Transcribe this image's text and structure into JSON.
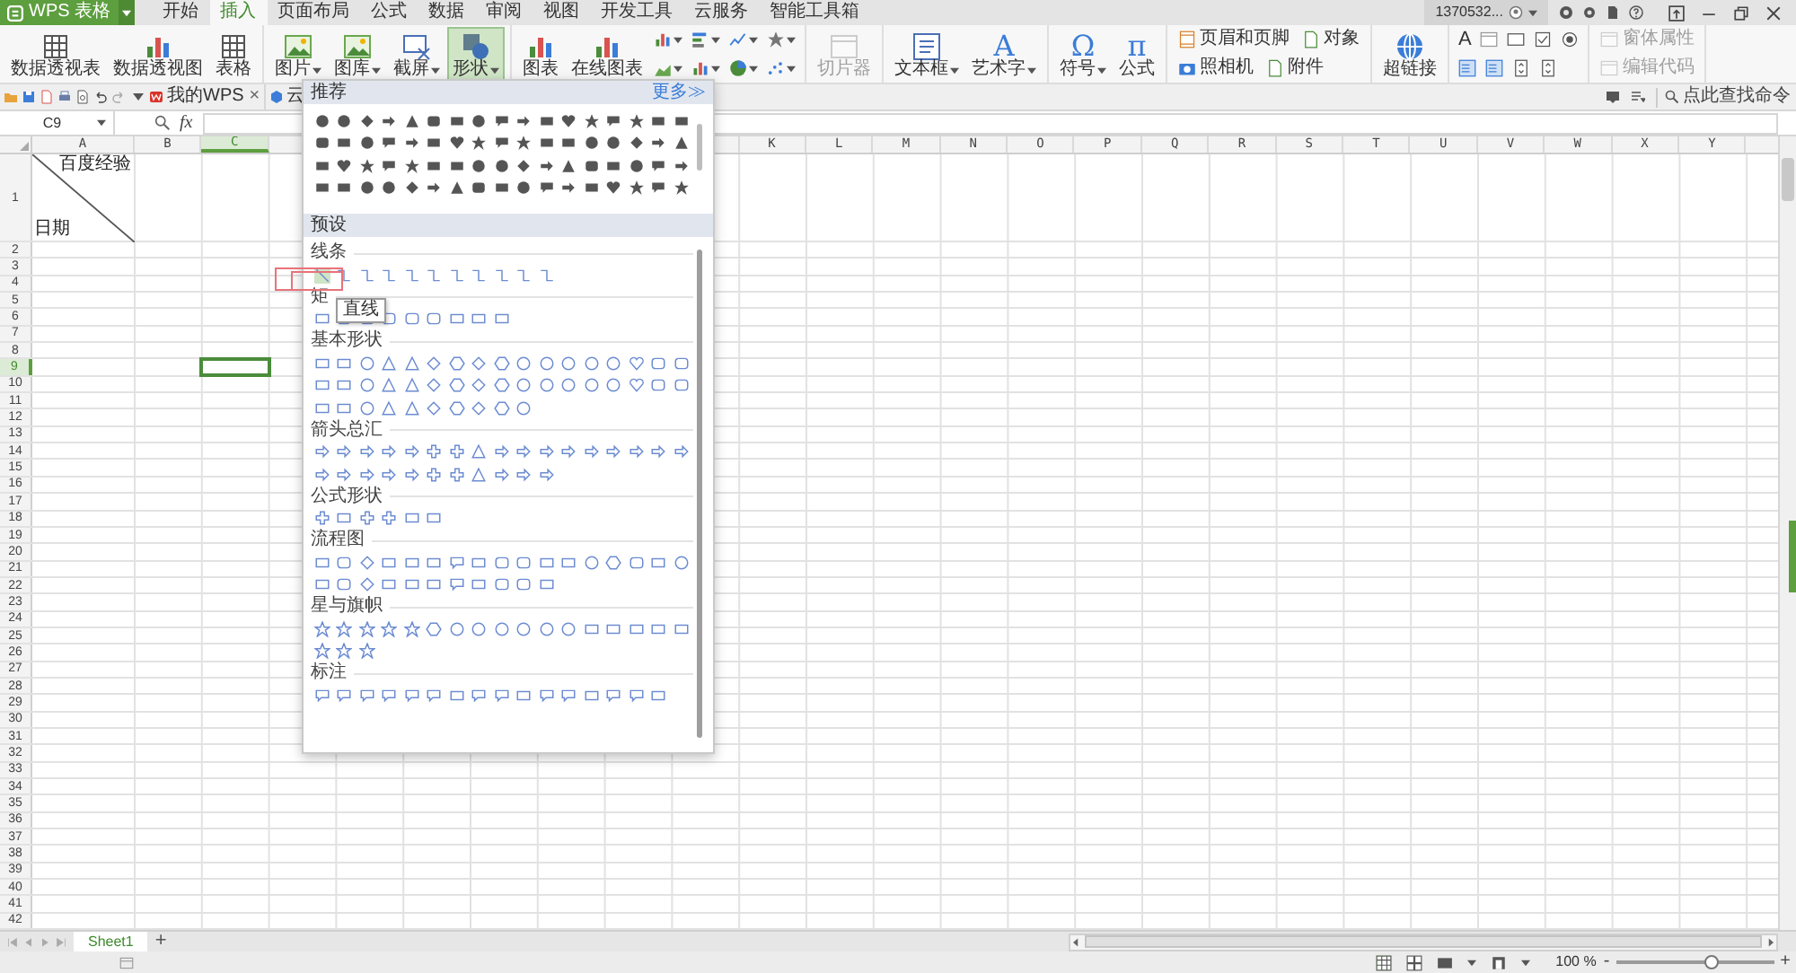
{
  "app_menu": {
    "label": "WPS 表格"
  },
  "menu_tabs": [
    {
      "label": "开始",
      "selected": false
    },
    {
      "label": "插入",
      "selected": true
    },
    {
      "label": "页面布局",
      "selected": false
    },
    {
      "label": "公式",
      "selected": false
    },
    {
      "label": "数据",
      "selected": false
    },
    {
      "label": "审阅",
      "selected": false
    },
    {
      "label": "视图",
      "selected": false
    },
    {
      "label": "开发工具",
      "selected": false
    },
    {
      "label": "云服务",
      "selected": false
    },
    {
      "label": "智能工具箱",
      "selected": false
    }
  ],
  "account": {
    "label": "1370532..."
  },
  "ribbon_groups": [
    {
      "items": [
        {
          "kind": "large",
          "label": "数据透视表",
          "dropdown": false,
          "selected": false,
          "disabled": false
        },
        {
          "kind": "large",
          "label": "数据透视图",
          "dropdown": false,
          "selected": false,
          "disabled": false
        },
        {
          "kind": "large",
          "label": "表格",
          "dropdown": false,
          "selected": false,
          "disabled": false
        }
      ]
    },
    {
      "items": [
        {
          "kind": "large",
          "label": "图片",
          "dropdown": true,
          "selected": false,
          "disabled": false
        },
        {
          "kind": "large",
          "label": "图库",
          "dropdown": true,
          "selected": false,
          "disabled": false
        },
        {
          "kind": "large",
          "label": "截屏",
          "dropdown": true,
          "selected": false,
          "disabled": false
        },
        {
          "kind": "large",
          "label": "形状",
          "dropdown": true,
          "selected": true,
          "disabled": false
        }
      ]
    },
    {
      "items": [
        {
          "kind": "large",
          "label": "图表",
          "dropdown": false,
          "selected": false,
          "disabled": false
        },
        {
          "kind": "large",
          "label": "在线图表",
          "dropdown": false,
          "selected": false,
          "disabled": false
        },
        {
          "kind": "icon",
          "dropdown": true,
          "selected": false,
          "disabled": false
        },
        {
          "kind": "icon",
          "dropdown": true,
          "selected": false,
          "disabled": false
        },
        {
          "kind": "icon",
          "dropdown": true,
          "selected": false,
          "disabled": false
        },
        {
          "kind": "icon",
          "dropdown": true,
          "selected": false,
          "disabled": false
        },
        {
          "kind": "icon",
          "dropdown": true,
          "selected": false,
          "disabled": false
        },
        {
          "kind": "icon",
          "dropdown": true,
          "selected": false,
          "disabled": false
        },
        {
          "kind": "icon",
          "dropdown": true,
          "selected": false,
          "disabled": false
        },
        {
          "kind": "icon",
          "dropdown": true,
          "selected": false,
          "disabled": false
        }
      ]
    },
    {
      "items": [
        {
          "kind": "large",
          "label": "切片器",
          "dropdown": false,
          "selected": false,
          "disabled": true
        }
      ]
    },
    {
      "items": [
        {
          "kind": "large",
          "label": "文本框",
          "dropdown": true,
          "selected": false,
          "disabled": false
        },
        {
          "kind": "large_glyph",
          "glyph": "A",
          "label": "艺术字",
          "dropdown": true,
          "selected": false,
          "disabled": false
        }
      ]
    },
    {
      "items": [
        {
          "kind": "large_glyph",
          "glyph": "Ω",
          "label": "符号",
          "dropdown": true,
          "selected": false,
          "disabled": false
        },
        {
          "kind": "large_glyph",
          "glyph": "π",
          "label": "公式",
          "dropdown": false,
          "selected": false,
          "disabled": false
        }
      ]
    },
    {
      "items": [
        {
          "kind": "small",
          "label": "页眉和页脚",
          "dropdown": false,
          "selected": false,
          "disabled": false
        },
        {
          "kind": "small",
          "label": "对象",
          "dropdown": false,
          "selected": false,
          "disabled": false
        },
        {
          "kind": "small",
          "label": "照相机",
          "dropdown": false,
          "selected": false,
          "disabled": false
        },
        {
          "kind": "small",
          "label": "附件",
          "dropdown": false,
          "selected": false,
          "disabled": false
        }
      ]
    },
    {
      "items": [
        {
          "kind": "large",
          "label": "超链接",
          "dropdown": false,
          "selected": false,
          "disabled": false
        }
      ]
    },
    {
      "items": [
        {
          "kind": "glyph",
          "glyph": "A",
          "dropdown": false,
          "selected": false,
          "disabled": false
        },
        {
          "kind": "icon",
          "dropdown": false,
          "selected": false,
          "disabled": false
        },
        {
          "kind": "icon",
          "dropdown": false,
          "selected": false,
          "disabled": false
        },
        {
          "kind": "icon",
          "dropdown": false,
          "selected": false,
          "disabled": false
        },
        {
          "kind": "icon",
          "dropdown": false,
          "selected": false,
          "disabled": false
        },
        {
          "kind": "icon",
          "dropdown": false,
          "selected": false,
          "disabled": false
        },
        {
          "kind": "icon",
          "dropdown": false,
          "selected": false,
          "disabled": false
        },
        {
          "kind": "icon",
          "dropdown": false,
          "selected": false,
          "disabled": false
        },
        {
          "kind": "icon",
          "dropdown": false,
          "selected": false,
          "disabled": false
        }
      ]
    },
    {
      "items": [
        {
          "kind": "small",
          "label": "窗体属性",
          "dropdown": false,
          "selected": false,
          "disabled": true
        },
        {
          "kind": "small",
          "label": "编辑代码",
          "dropdown": false,
          "selected": false,
          "disabled": true
        }
      ]
    }
  ],
  "doc_tabs": [
    {
      "label": "我的WPS",
      "close": "×"
    },
    {
      "label": "云"
    }
  ],
  "command_search": {
    "placeholder": "点此查找命令"
  },
  "formula_bar": {
    "cell_name": "C9",
    "fx": "fx"
  },
  "sheet": {
    "columns": [
      {
        "label": "A",
        "selected": false
      },
      {
        "label": "B",
        "selected": false
      },
      {
        "label": "C",
        "selected": true
      },
      {
        "label": "K",
        "selected": false
      },
      {
        "label": "L",
        "selected": false
      },
      {
        "label": "M",
        "selected": false
      },
      {
        "label": "N",
        "selected": false
      },
      {
        "label": "O",
        "selected": false
      },
      {
        "label": "P",
        "selected": false
      },
      {
        "label": "Q",
        "selected": false
      },
      {
        "label": "R",
        "selected": false
      },
      {
        "label": "S",
        "selected": false
      },
      {
        "label": "T",
        "selected": false
      },
      {
        "label": "U",
        "selected": false
      },
      {
        "label": "V",
        "selected": false
      },
      {
        "label": "W",
        "selected": false
      },
      {
        "label": "X",
        "selected": false
      },
      {
        "label": "Y",
        "selected": false
      }
    ],
    "rows": [
      {
        "label": "1",
        "selected": false
      },
      {
        "label": "2",
        "selected": false
      },
      {
        "label": "3",
        "selected": false
      },
      {
        "label": "4",
        "selected": false
      },
      {
        "label": "5",
        "selected": false
      },
      {
        "label": "6",
        "selected": false
      },
      {
        "label": "7",
        "selected": false
      },
      {
        "label": "8",
        "selected": false
      },
      {
        "label": "9",
        "selected": true
      },
      {
        "label": "10",
        "selected": false
      },
      {
        "label": "11",
        "selected": false
      },
      {
        "label": "12",
        "selected": false
      },
      {
        "label": "13",
        "selected": false
      },
      {
        "label": "14",
        "selected": false
      },
      {
        "label": "15",
        "selected": false
      },
      {
        "label": "16",
        "selected": false
      },
      {
        "label": "17",
        "selected": false
      },
      {
        "label": "18",
        "selected": false
      },
      {
        "label": "19",
        "selected": false
      },
      {
        "label": "20",
        "selected": false
      },
      {
        "label": "21",
        "selected": false
      },
      {
        "label": "22",
        "selected": false
      },
      {
        "label": "23",
        "selected": false
      },
      {
        "label": "24",
        "selected": false
      },
      {
        "label": "25",
        "selected": false
      },
      {
        "label": "26",
        "selected": false
      },
      {
        "label": "27",
        "selected": false
      },
      {
        "label": "28",
        "selected": false
      },
      {
        "label": "29",
        "selected": false
      },
      {
        "label": "30",
        "selected": false
      },
      {
        "label": "31",
        "selected": false
      },
      {
        "label": "32",
        "selected": false
      },
      {
        "label": "33",
        "selected": false
      },
      {
        "label": "34",
        "selected": false
      },
      {
        "label": "35",
        "selected": false
      },
      {
        "label": "36",
        "selected": false
      },
      {
        "label": "37",
        "selected": false
      },
      {
        "label": "38",
        "selected": false
      },
      {
        "label": "39",
        "selected": false
      },
      {
        "label": "40",
        "selected": false
      },
      {
        "label": "41",
        "selected": false
      },
      {
        "label": "42",
        "selected": false
      }
    ],
    "cell_a1": {
      "top_text": "百度经验",
      "bottom_text": "日期"
    }
  },
  "shape_menu": {
    "recommended_title": "推荐",
    "more": "更多≫",
    "presets_title": "预设",
    "tooltip": "直线",
    "sections": [
      {
        "title": "线条",
        "kind": "lines",
        "selected": true
      },
      {
        "title": "矩",
        "kind": "rects",
        "selected": false
      },
      {
        "title": "基本形状",
        "kind": "basic",
        "selected": false
      },
      {
        "title": "箭头总汇",
        "kind": "arrows",
        "selected": false
      },
      {
        "title": "公式形状",
        "kind": "math",
        "selected": false
      },
      {
        "title": "流程图",
        "kind": "flow",
        "selected": false
      },
      {
        "title": "星与旗帜",
        "kind": "stars",
        "selected": false
      },
      {
        "title": "标注",
        "kind": "callouts",
        "selected": false
      }
    ]
  },
  "sheet_tabs": [
    {
      "label": "Sheet1",
      "selected": true
    }
  ],
  "add_sheet": "+",
  "status_bar": {
    "zoom": "100 %",
    "zoom_out": "-",
    "zoom_in": "+",
    "zoom_slider": {
      "level": 0.6
    }
  }
}
